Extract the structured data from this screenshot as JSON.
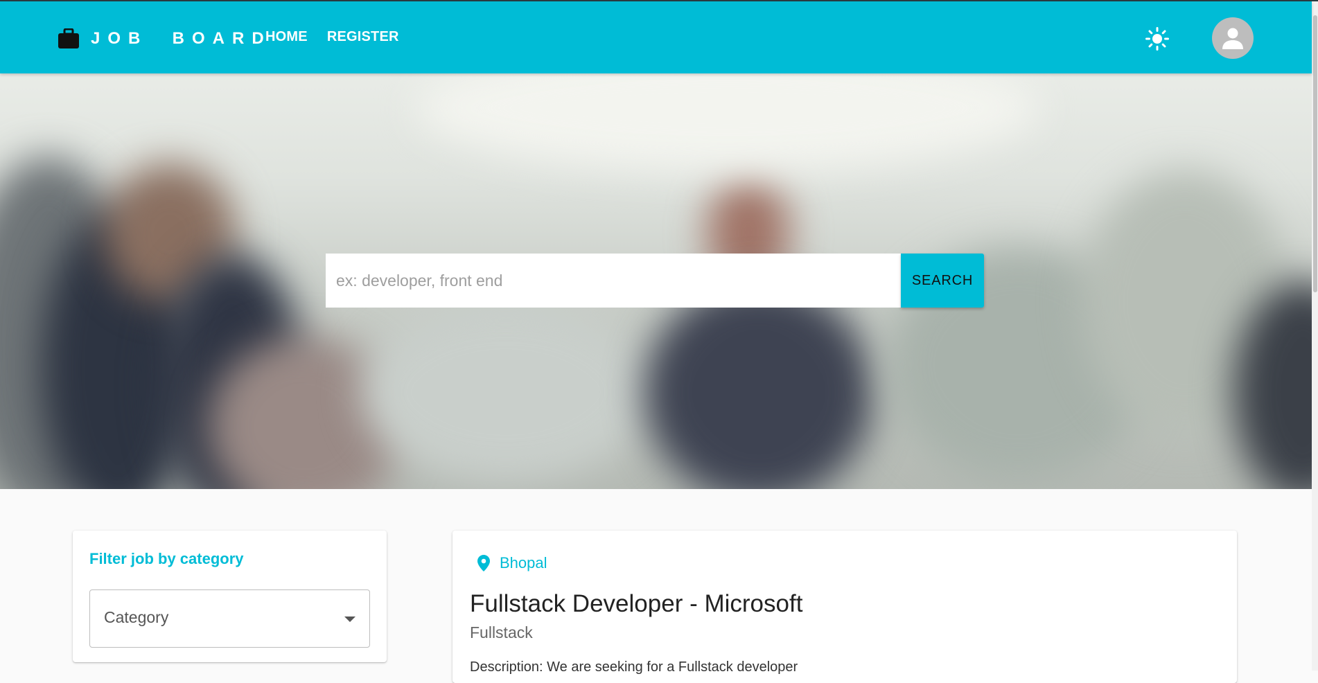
{
  "appbar": {
    "brand_label": "JOB  BOARD",
    "nav": {
      "home": "HOME",
      "register": "REGISTER"
    },
    "theme_icon": "sun-icon",
    "avatar_icon": "person-icon",
    "accent_color": "#00bcd6"
  },
  "hero": {
    "search": {
      "placeholder": "ex: developer, front end",
      "value": "",
      "button_label": "SEARCH"
    }
  },
  "filter": {
    "title": "Filter job by category",
    "select_label": "Category"
  },
  "jobs": [
    {
      "location": "Bhopal",
      "title": "Fullstack Developer - Microsoft",
      "category": "Fullstack",
      "description": "Description: We are seeking for a Fullstack developer"
    }
  ]
}
